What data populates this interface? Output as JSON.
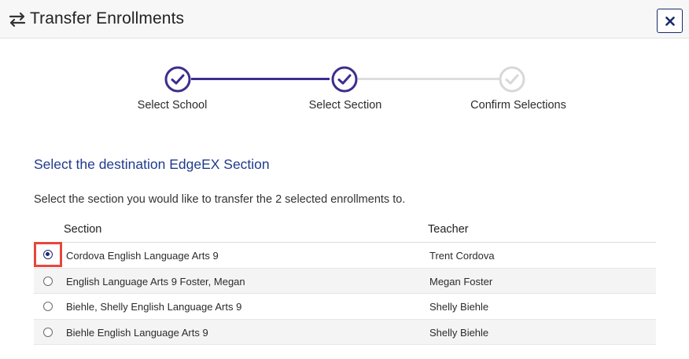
{
  "header": {
    "title": "Transfer Enrollments",
    "icon": "transfer-arrows-icon",
    "close_icon": "close-icon"
  },
  "stepper": {
    "steps": [
      {
        "label": "Select School",
        "state": "complete"
      },
      {
        "label": "Select Section",
        "state": "complete"
      },
      {
        "label": "Confirm Selections",
        "state": "pending"
      }
    ]
  },
  "content": {
    "title": "Select the destination EdgeEX Section",
    "instruction": "Select the section you would like to transfer the 2 selected enrollments to."
  },
  "table": {
    "columns": {
      "section": "Section",
      "teacher": "Teacher"
    },
    "rows": [
      {
        "section": "Cordova English Language Arts 9",
        "teacher": "Trent Cordova",
        "selected": true
      },
      {
        "section": "English Language Arts 9 Foster, Megan",
        "teacher": "Megan Foster",
        "selected": false
      },
      {
        "section": "Biehle, Shelly English Language Arts 9",
        "teacher": "Shelly Biehle",
        "selected": false
      },
      {
        "section": "Biehle English Language Arts 9",
        "teacher": "Shelly Biehle",
        "selected": false
      }
    ]
  },
  "colors": {
    "accent": "#3d2d8e",
    "title_blue": "#1f3b8c",
    "pending": "#dddddd",
    "highlight": "#e8473b"
  }
}
